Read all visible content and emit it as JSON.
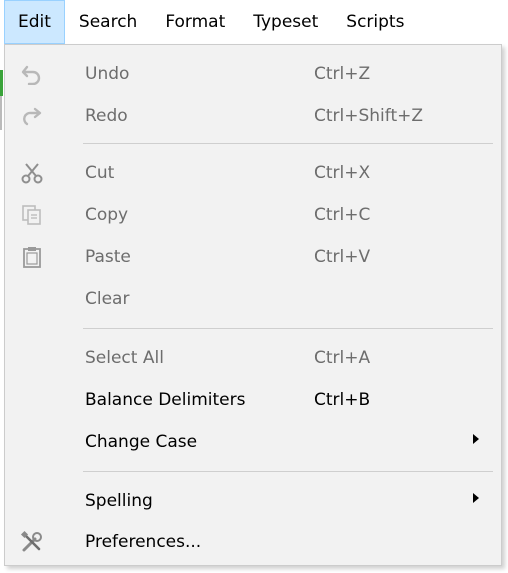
{
  "menubar": {
    "items": [
      {
        "label": "Edit"
      },
      {
        "label": "Search"
      },
      {
        "label": "Format"
      },
      {
        "label": "Typeset"
      },
      {
        "label": "Scripts"
      }
    ]
  },
  "edit_menu": {
    "items": [
      {
        "label": "Undo",
        "shortcut": "Ctrl+Z",
        "icon": "undo-icon",
        "enabled": false
      },
      {
        "label": "Redo",
        "shortcut": "Ctrl+Shift+Z",
        "icon": "redo-icon",
        "enabled": false
      },
      {
        "label": "Cut",
        "shortcut": "Ctrl+X",
        "icon": "scissors-icon",
        "enabled": false
      },
      {
        "label": "Copy",
        "shortcut": "Ctrl+C",
        "icon": "copy-icon",
        "enabled": false
      },
      {
        "label": "Paste",
        "shortcut": "Ctrl+V",
        "icon": "clipboard-icon",
        "enabled": false
      },
      {
        "label": "Clear",
        "shortcut": "",
        "enabled": false
      },
      {
        "label": "Select All",
        "shortcut": "Ctrl+A",
        "enabled": false
      },
      {
        "label": "Balance Delimiters",
        "shortcut": "Ctrl+B",
        "enabled": true
      },
      {
        "label": "Change Case",
        "shortcut": "",
        "enabled": true,
        "submenu": true
      },
      {
        "label": "Spelling",
        "shortcut": "",
        "enabled": true,
        "submenu": true
      },
      {
        "label": "Preferences...",
        "shortcut": "",
        "icon": "tools-icon",
        "enabled": true
      }
    ]
  },
  "colors": {
    "active_menu_bg": "#cce8ff",
    "active_menu_border": "#99d1ff",
    "dropdown_bg": "#f2f2f2",
    "disabled_text": "#6d6d6d"
  }
}
